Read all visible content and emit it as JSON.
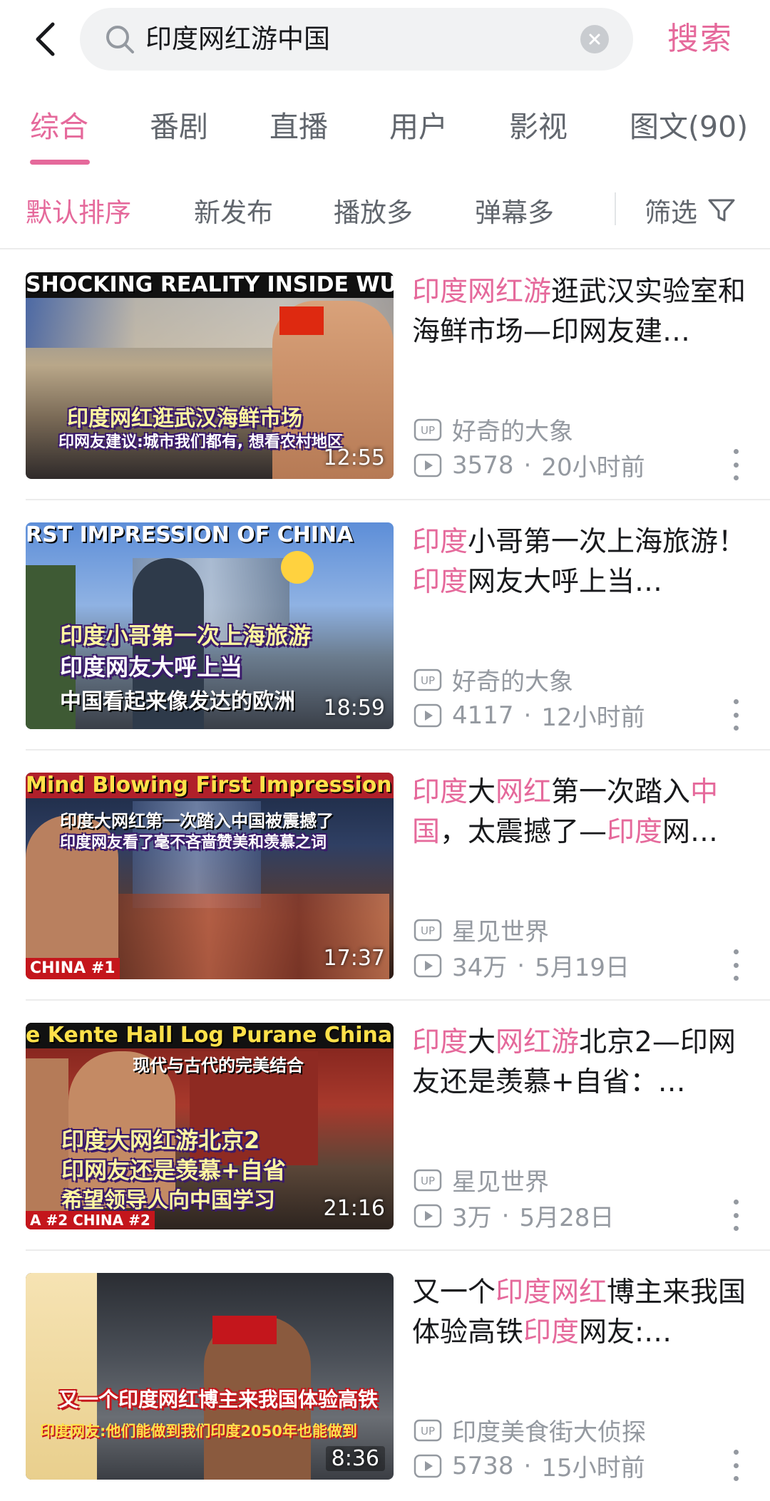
{
  "colors": {
    "accent": "#e5699b",
    "text": "#18191c",
    "muted": "#9499a0"
  },
  "header": {
    "back_icon": "chevron-left-icon",
    "search_icon": "search-icon",
    "query": "印度网红游中国",
    "clear_icon": "clear-icon",
    "submit_label": "搜索"
  },
  "tabs": [
    {
      "label": "综合",
      "active": true
    },
    {
      "label": "番剧"
    },
    {
      "label": "直播"
    },
    {
      "label": "用户"
    },
    {
      "label": "影视"
    },
    {
      "label": "图文(90)"
    }
  ],
  "sort": {
    "options": [
      "默认排序",
      "新发布",
      "播放多",
      "弹幕多"
    ],
    "active_index": 0,
    "filter_label": "筛选",
    "filter_icon": "funnel-icon"
  },
  "videos": [
    {
      "thumb_top": "SHOCKING REALITY INSIDE WUHAN, CHI",
      "thumb_caption": "印度网红逛武汉海鲜市场",
      "thumb_caption2": "印网友建议:城市我们都有, 想看农村地区",
      "duration": "12:55",
      "title_parts": [
        [
          "印度网红游",
          true
        ],
        [
          "逛武汉实验室和海鲜市场—印网友建…",
          false
        ]
      ],
      "uploader": "好奇的大象",
      "views": "3578",
      "date": "20小时前"
    },
    {
      "thumb_top": "RST IMPRESSION OF CHINA",
      "thumb_caption": "印度小哥第一次上海旅游",
      "thumb_caption2": "印度网友大呼上当",
      "thumb_caption3": "中国看起来像发达的欧洲",
      "duration": "18:59",
      "title_parts": [
        [
          "印度",
          true
        ],
        [
          "小哥第一次上海旅游！",
          false
        ],
        [
          "印度",
          true
        ],
        [
          "网友大呼上当…",
          false
        ]
      ],
      "uploader": "好奇的大象",
      "views": "4117",
      "date": "12小时前"
    },
    {
      "thumb_top": "Mind Blowing First Impression of Ch",
      "thumb_caption": "印度大网红第一次踏入中国被震撼了",
      "thumb_caption2": "印度网友看了毫不吝啬赞美和羡慕之词",
      "thumb_bottom": "CHINA #1",
      "duration": "17:37",
      "title_parts": [
        [
          "印度",
          true
        ],
        [
          "大",
          false
        ],
        [
          "网红",
          true
        ],
        [
          "第一次踏入",
          false
        ],
        [
          "中国",
          true
        ],
        [
          "，太震撼了—",
          false
        ],
        [
          "印度",
          true
        ],
        [
          "网…",
          false
        ]
      ],
      "uploader": "星见世界",
      "views": "34万",
      "date": "5月19日"
    },
    {
      "thumb_top": "e Kente Hall Log Purane China me",
      "thumb_caption": "现代与古代的完美结合",
      "thumb_caption2": "印度大网红游北京2",
      "thumb_caption3": "印网友还是羡慕+自省",
      "thumb_caption4": "希望领导人向中国学习",
      "thumb_bottom": "A #2 CHINA #2",
      "duration": "21:16",
      "title_parts": [
        [
          "印度",
          true
        ],
        [
          "大",
          false
        ],
        [
          "网红游",
          true
        ],
        [
          "北京2—印网友还是羡慕+自省：…",
          false
        ]
      ],
      "uploader": "星见世界",
      "views": "3万",
      "date": "5月28日"
    },
    {
      "thumb_caption": "又一个印度网红博主来我国体验高铁",
      "thumb_caption2": "印度网友:他们能做到我们印度2050年也能做到",
      "duration": "8:36",
      "title_parts": [
        [
          "又一个",
          false
        ],
        [
          "印度网红",
          true
        ],
        [
          "博主来我国体验高铁",
          false
        ],
        [
          "印度",
          true
        ],
        [
          "网友:…",
          false
        ]
      ],
      "uploader": "印度美食街大侦探",
      "views": "5738",
      "date": "15小时前"
    }
  ]
}
